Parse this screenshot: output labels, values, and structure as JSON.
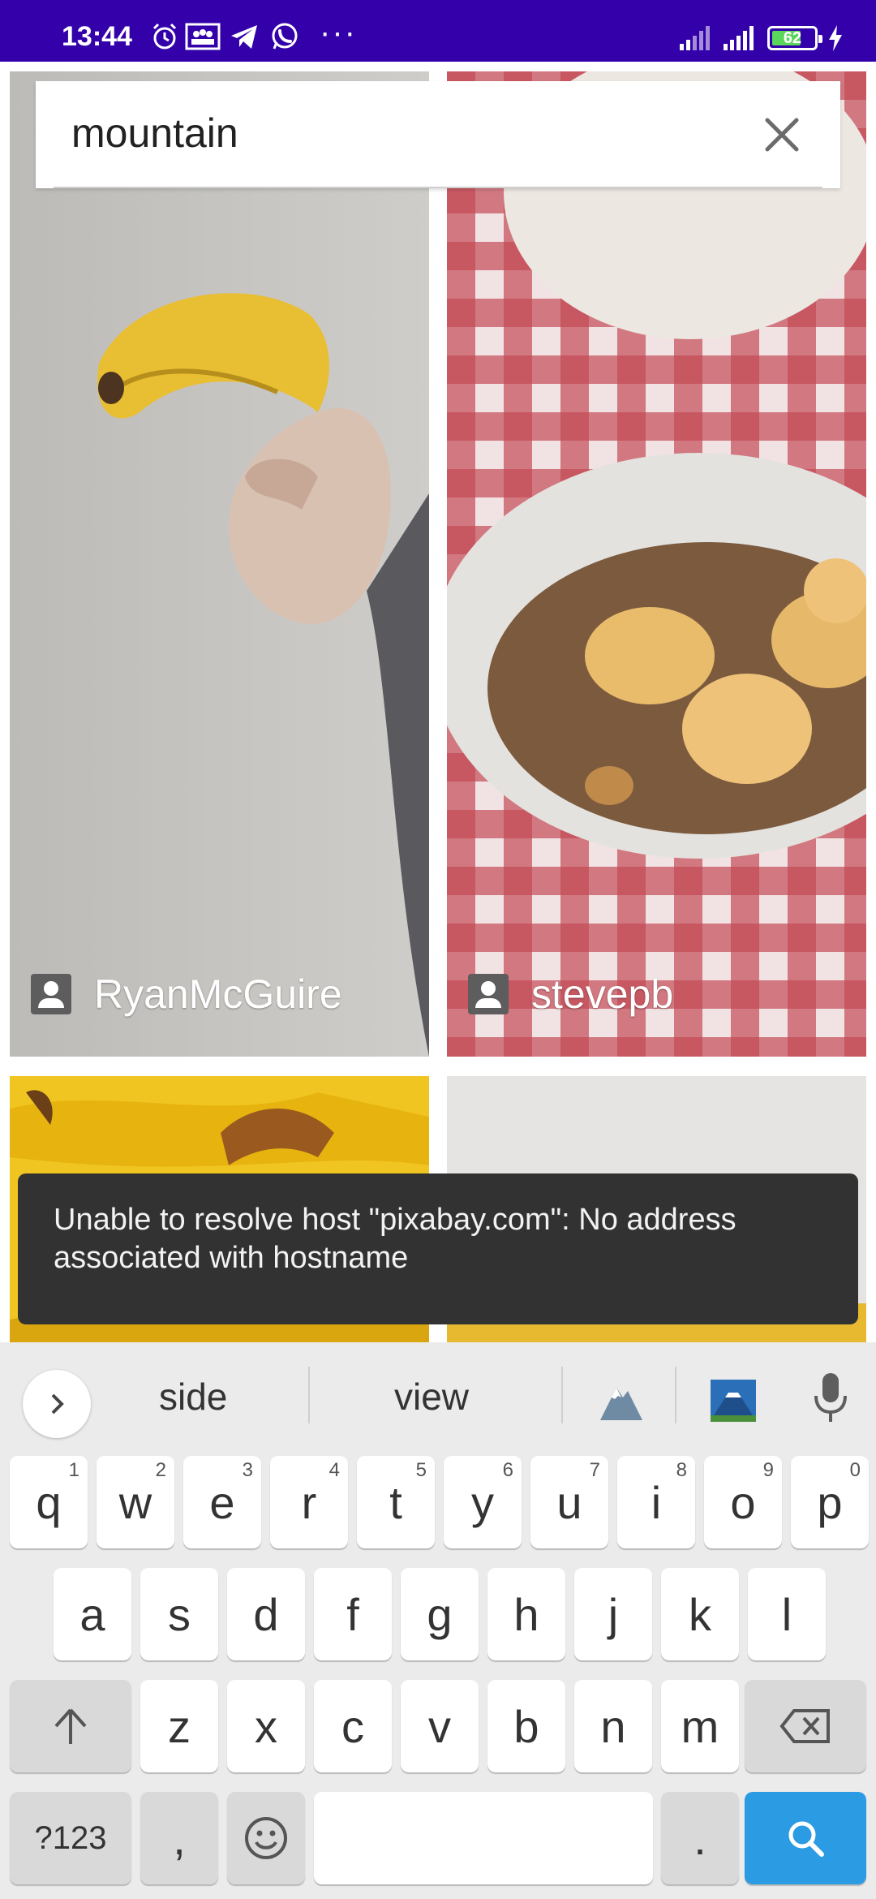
{
  "status_bar": {
    "time": "13:44",
    "overflow": "···",
    "battery": "62",
    "left_icons": [
      "alarm-icon",
      "team-icon",
      "telegram-icon",
      "whatsapp-icon"
    ],
    "right_icons": [
      "signal-icon",
      "signal-icon",
      "battery-icon",
      "charging-icon"
    ],
    "background": "#3300aa"
  },
  "search": {
    "value": "mountain",
    "placeholder": "",
    "clear_icon": "close-icon"
  },
  "grid": {
    "items": [
      {
        "author": "RyanMcGuire",
        "subject": "banana-in-hand"
      },
      {
        "author": "stevepb",
        "subject": "banana-cereal-bowl"
      },
      {
        "author": "",
        "subject": "bananas"
      },
      {
        "author": "",
        "subject": "banana"
      }
    ]
  },
  "toast": {
    "message": "Unable to resolve host \"pixabay.com\": No address associated with hostname"
  },
  "keyboard": {
    "suggestions": [
      "side",
      "view"
    ],
    "suggestion_emojis": [
      "mountain-emoji",
      "mount-fuji-emoji"
    ],
    "row1": [
      "q",
      "w",
      "e",
      "r",
      "t",
      "y",
      "u",
      "i",
      "o",
      "p"
    ],
    "row1_hints": [
      "1",
      "2",
      "3",
      "4",
      "5",
      "6",
      "7",
      "8",
      "9",
      "0"
    ],
    "row2": [
      "a",
      "s",
      "d",
      "f",
      "g",
      "h",
      "j",
      "k",
      "l"
    ],
    "row3": [
      "z",
      "x",
      "c",
      "v",
      "b",
      "n",
      "m"
    ],
    "symbols_label": "?123",
    "comma_label": ",",
    "period_label": ".",
    "accent": "#2b9be3"
  }
}
